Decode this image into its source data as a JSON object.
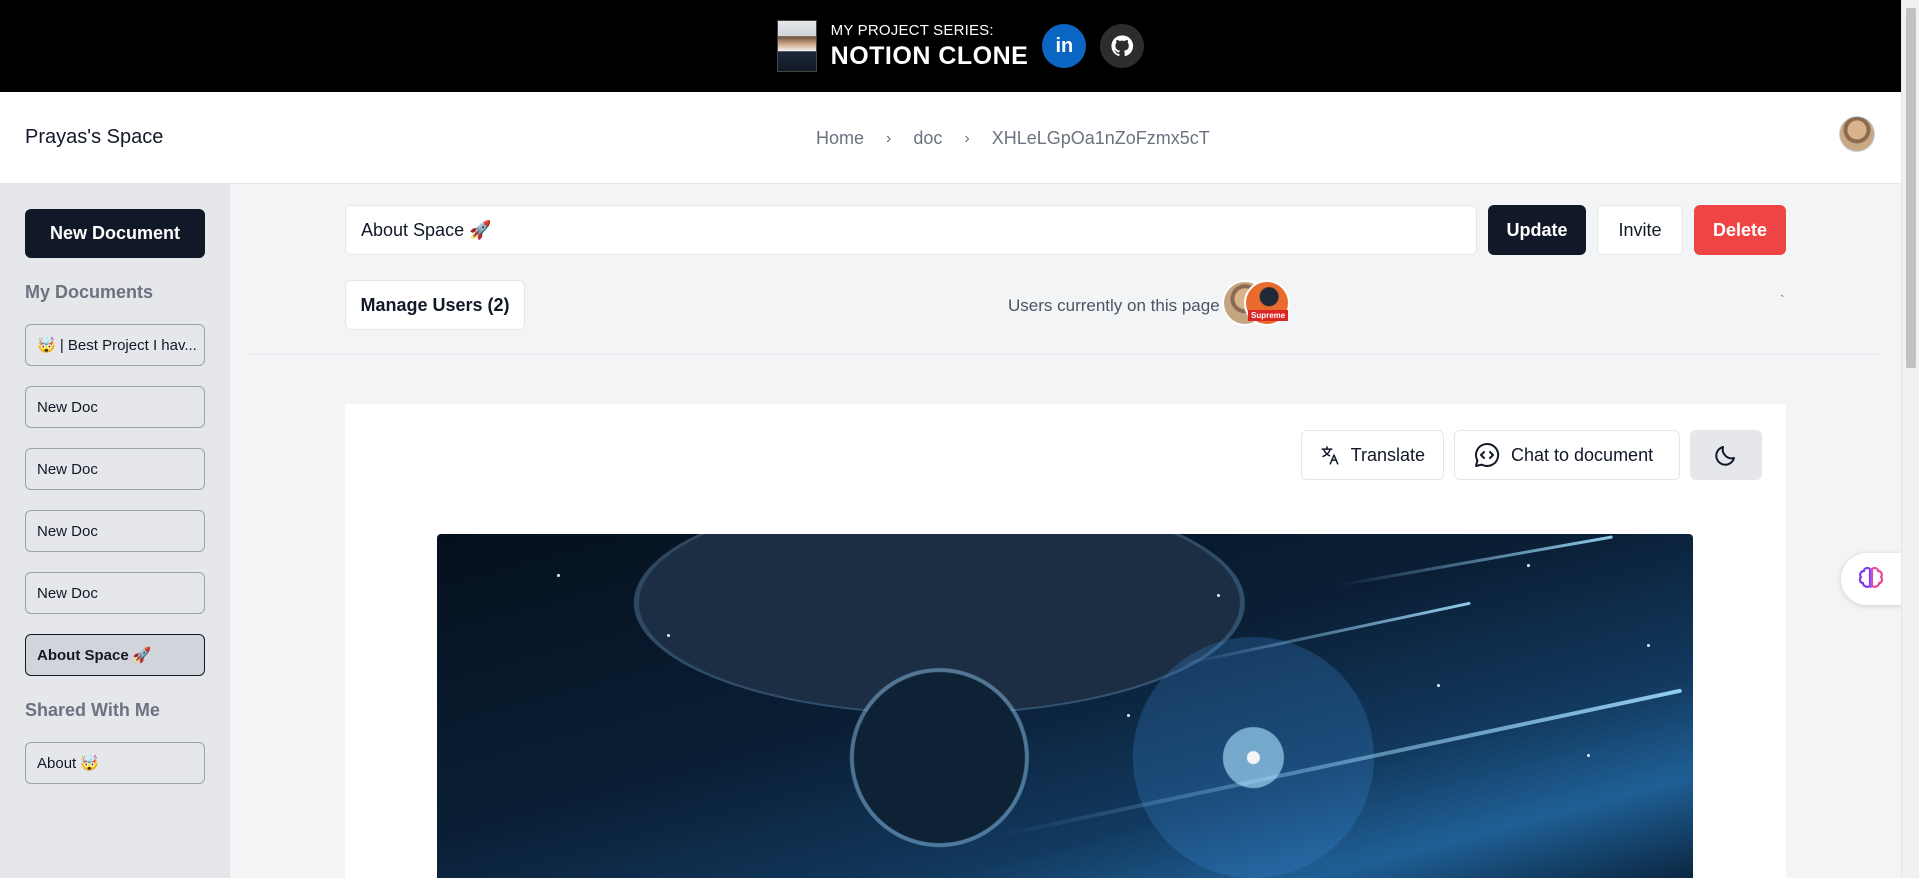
{
  "banner": {
    "subtitle": "MY PROJECT SERIES:",
    "title": "NOTION CLONE",
    "linkedin_label": "in"
  },
  "header": {
    "space_title": "Prayas's Space",
    "breadcrumb": [
      "Home",
      "doc",
      "XHLeLGpOa1nZoFzmx5cT"
    ]
  },
  "sidebar": {
    "new_document_label": "New Document",
    "my_documents_label": "My Documents",
    "my_documents": [
      {
        "label": "🤯 | Best Project I hav..."
      },
      {
        "label": "New Doc"
      },
      {
        "label": "New Doc"
      },
      {
        "label": "New Doc"
      },
      {
        "label": "New Doc"
      },
      {
        "label": "About Space 🚀",
        "active": true
      }
    ],
    "shared_label": "Shared With Me",
    "shared_documents": [
      {
        "label": "About 🤯"
      }
    ]
  },
  "main": {
    "title_value": "About Space 🚀",
    "update_label": "Update",
    "invite_label": "Invite",
    "delete_label": "Delete",
    "manage_users_label": "Manage Users (2)",
    "presence_label": "Users currently on this page",
    "presence_badge": "Supreme",
    "tick": "`"
  },
  "editor": {
    "translate_label": "Translate",
    "chat_label": "Chat to document"
  },
  "colors": {
    "primary": "#111827",
    "danger": "#ef4444",
    "linkedin": "#0a66c2",
    "sidebar_bg": "#e5e7eb"
  },
  "icons": [
    "linkedin-icon",
    "github-icon",
    "chevron-right-icon",
    "translate-icon",
    "chat-icon",
    "moon-icon",
    "brain-icon"
  ]
}
